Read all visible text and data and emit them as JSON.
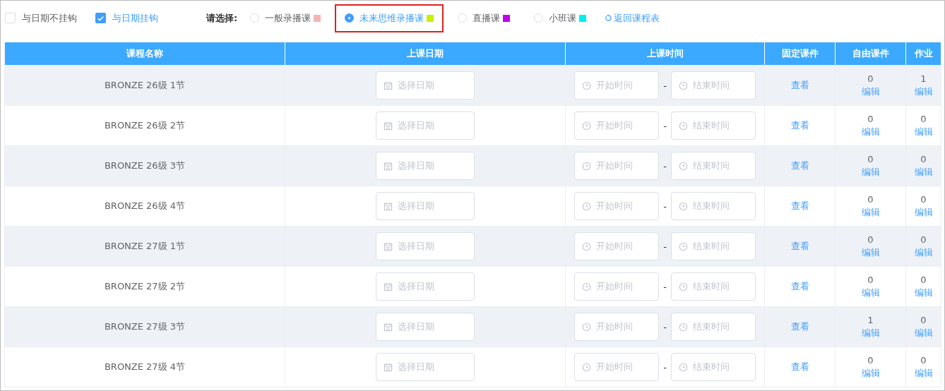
{
  "filters": {
    "checkboxes": [
      {
        "label": "与日期不挂钩",
        "checked": false
      },
      {
        "label": "与日期挂钩",
        "checked": true
      }
    ],
    "prompt": "请选择:",
    "options": [
      {
        "label": "一般录播课",
        "selected": false,
        "color": "#f4b4b4"
      },
      {
        "label": "未来思维录播课",
        "selected": true,
        "color": "#c8f000"
      },
      {
        "label": "直播课",
        "selected": false,
        "color": "#c000f0"
      },
      {
        "label": "小班课",
        "selected": false,
        "color": "#00f0f0"
      }
    ],
    "back_link": "返回课程表"
  },
  "table": {
    "columns": [
      "课程名称",
      "上课日期",
      "上课时间",
      "固定课件",
      "自由课件",
      "作业"
    ],
    "rows": [
      {
        "name": "BRONZE 26级 1节",
        "date": "选择日期",
        "start": "开始时间",
        "sep": "-",
        "end": "结束时间",
        "view": "查看",
        "free": "0",
        "free_edit": "编辑",
        "homework": "1",
        "homework_edit": "编辑"
      },
      {
        "name": "BRONZE 26级 2节",
        "date": "选择日期",
        "start": "开始时间",
        "sep": "-",
        "end": "结束时间",
        "view": "查看",
        "free": "0",
        "free_edit": "编辑",
        "homework": "0",
        "homework_edit": "编辑"
      },
      {
        "name": "BRONZE 26级 3节",
        "date": "选择日期",
        "start": "开始时间",
        "sep": "-",
        "end": "结束时间",
        "view": "查看",
        "free": "0",
        "free_edit": "编辑",
        "homework": "0",
        "homework_edit": "编辑"
      },
      {
        "name": "BRONZE 26级 4节",
        "date": "选择日期",
        "start": "开始时间",
        "sep": "-",
        "end": "结束时间",
        "view": "查看",
        "free": "0",
        "free_edit": "编辑",
        "homework": "0",
        "homework_edit": "编辑"
      },
      {
        "name": "BRONZE 27级 1节",
        "date": "选择日期",
        "start": "开始时间",
        "sep": "-",
        "end": "结束时间",
        "view": "查看",
        "free": "0",
        "free_edit": "编辑",
        "homework": "0",
        "homework_edit": "编辑"
      },
      {
        "name": "BRONZE 27级 2节",
        "date": "选择日期",
        "start": "开始时间",
        "sep": "-",
        "end": "结束时间",
        "view": "查看",
        "free": "0",
        "free_edit": "编辑",
        "homework": "0",
        "homework_edit": "编辑"
      },
      {
        "name": "BRONZE 27级 3节",
        "date": "选择日期",
        "start": "开始时间",
        "sep": "-",
        "end": "结束时间",
        "view": "查看",
        "free": "1",
        "free_edit": "编辑",
        "homework": "0",
        "homework_edit": "编辑"
      },
      {
        "name": "BRONZE 27级 4节",
        "date": "选择日期",
        "start": "开始时间",
        "sep": "-",
        "end": "结束时间",
        "view": "查看",
        "free": "0",
        "free_edit": "编辑",
        "homework": "0",
        "homework_edit": "编辑"
      }
    ]
  }
}
